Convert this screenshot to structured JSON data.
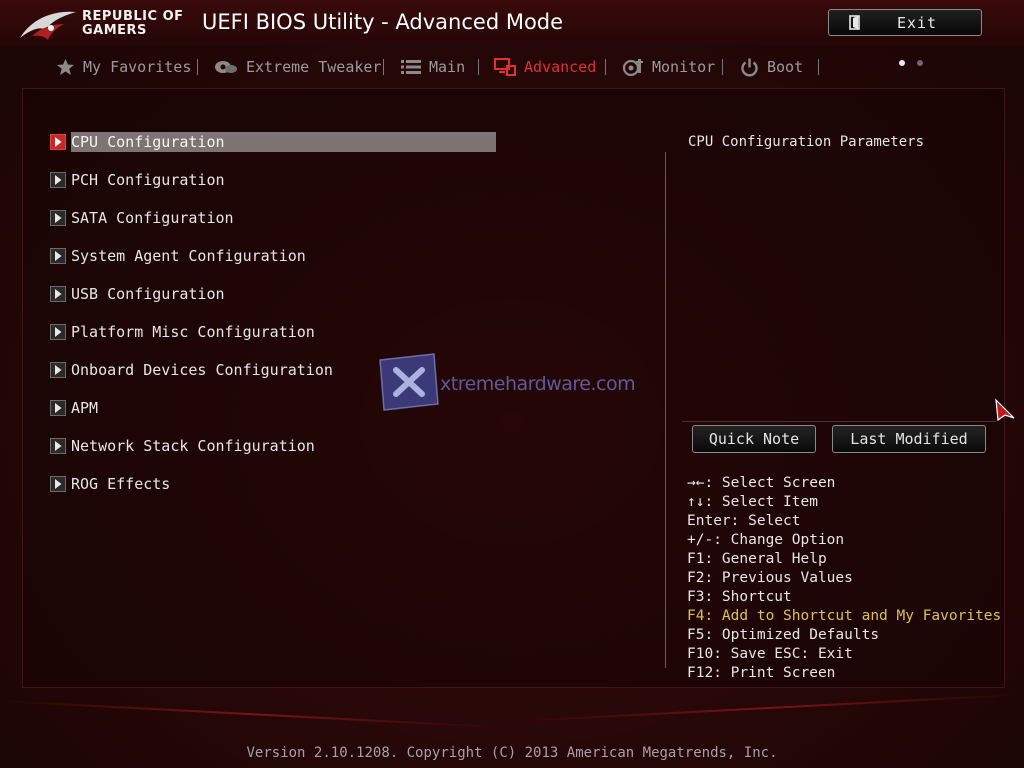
{
  "header": {
    "brand_line1": "REPUBLIC OF",
    "brand_line2": "GAMERS",
    "title": "UEFI BIOS Utility - Advanced Mode",
    "exit_label": "Exit"
  },
  "tabs": [
    {
      "label": "My Favorites",
      "icon": "star-icon",
      "active": false
    },
    {
      "label": "Extreme Tweaker",
      "icon": "tweaker-icon",
      "active": false
    },
    {
      "label": "Main",
      "icon": "list-icon",
      "active": false
    },
    {
      "label": "Advanced",
      "icon": "advanced-icon",
      "active": true
    },
    {
      "label": "Monitor",
      "icon": "monitor-icon",
      "active": false
    },
    {
      "label": "Boot",
      "icon": "power-icon",
      "active": false
    }
  ],
  "menu": {
    "selected_index": 0,
    "items": [
      "CPU Configuration",
      "PCH Configuration",
      "SATA Configuration",
      "System Agent Configuration",
      "USB Configuration",
      "Platform Misc Configuration",
      "Onboard Devices Configuration",
      "APM",
      "Network Stack Configuration",
      "ROG Effects"
    ]
  },
  "help": {
    "title": "CPU Configuration Parameters",
    "quick_note": "Quick Note",
    "last_modified": "Last Modified"
  },
  "shortcuts": [
    {
      "text": "→←: Select Screen",
      "highlight": false
    },
    {
      "text": "↑↓: Select Item",
      "highlight": false
    },
    {
      "text": "Enter: Select",
      "highlight": false
    },
    {
      "text": "+/-: Change Option",
      "highlight": false
    },
    {
      "text": "F1: General Help",
      "highlight": false
    },
    {
      "text": "F2: Previous Values",
      "highlight": false
    },
    {
      "text": "F3: Shortcut",
      "highlight": false
    },
    {
      "text": "F4: Add to Shortcut and My Favorites",
      "highlight": true
    },
    {
      "text": "F5: Optimized Defaults",
      "highlight": false
    },
    {
      "text": "F10: Save  ESC: Exit",
      "highlight": false
    },
    {
      "text": "F12: Print Screen",
      "highlight": false
    }
  ],
  "watermark": "xtremehardware.com",
  "footer": "Version 2.10.1208. Copyright (C) 2013 American Megatrends, Inc.",
  "colors": {
    "accent": "#e03030",
    "selected_bg": "#7d7474",
    "highlight_text": "#e0c14a"
  }
}
